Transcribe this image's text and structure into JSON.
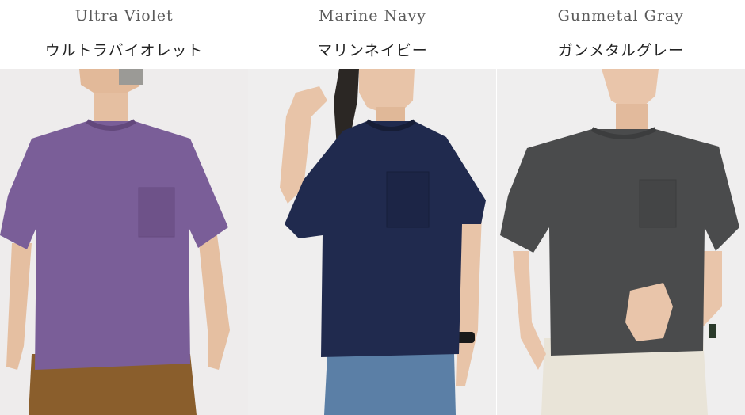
{
  "products": [
    {
      "name_en": "Ultra Violet",
      "name_ja": "ウルトラバイオレット",
      "shirt_color": "#7a5e98",
      "shirt_shade": "#6a4f86",
      "bottom_color": "#8a5e2c",
      "bg": "#efeeee",
      "photo": "ultra-violet-model-photo"
    },
    {
      "name_en": "Marine Navy",
      "name_ja": "マリンネイビー",
      "shirt_color": "#202a4e",
      "shirt_shade": "#182040",
      "bottom_color": "#5b7fa6",
      "bg": "#efeeee",
      "photo": "marine-navy-model-photo"
    },
    {
      "name_en": "Gunmetal Gray",
      "name_ja": "ガンメタルグレー",
      "shirt_color": "#4a4b4c",
      "shirt_shade": "#3d3e3f",
      "bottom_color": "#e9e4d8",
      "bg": "#efeeee",
      "photo": "gunmetal-gray-model-photo"
    }
  ],
  "skin_color": "#e8c4a8"
}
